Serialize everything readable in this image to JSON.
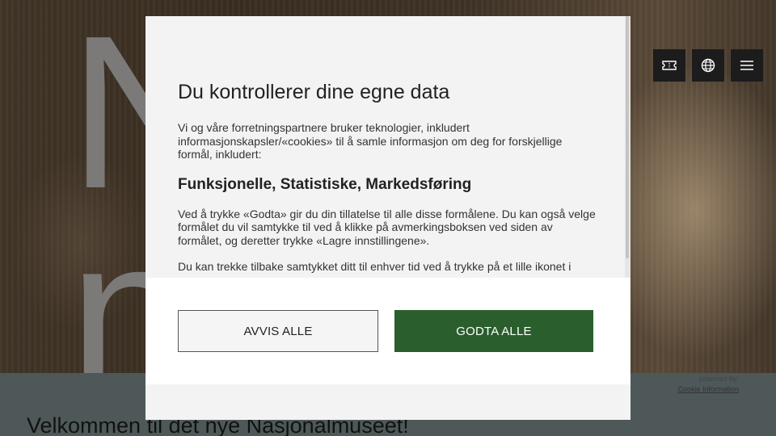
{
  "hero": {
    "letters": [
      "N",
      "n"
    ]
  },
  "top_buttons": [
    {
      "icon": "ticket-icon",
      "label": "Ticket"
    },
    {
      "icon": "globe-icon",
      "label": "Language"
    },
    {
      "icon": "menu-icon",
      "label": "Menu"
    }
  ],
  "page": {
    "welcome": "Velkommen til det nye Nasjonalmuseet!"
  },
  "cookie_dialog": {
    "title": "Du kontrollerer dine egne data",
    "intro": "Vi og våre forretningspartnere bruker teknologier, inkludert informasjonskapsler/«cookies» til å samle informasjon om deg for forskjellige formål, inkludert:",
    "purposes": "Funksjonelle, Statistiske, Markedsføring",
    "consent_text": "Ved å trykke «Godta» gir du din tillatelse til alle disse formålene. Du kan også velge formålet du vil samtykke til ved å klikke på avmerkingsboksen ved siden av formålet, og deretter trykke «Lagre innstillingene».",
    "withdraw_text": "Du kan trekke tilbake samtykket ditt til enhver tid ved å trykke på et lille ikonet i",
    "reject_label": "AVVIS ALLE",
    "accept_label": "GODTA ALLE",
    "powered_by": "powered by:",
    "provider": "Cookie Information"
  },
  "colors": {
    "accept": "#2a5e2c",
    "dialog_bg": "#f3f3f3",
    "band": "#4e5859"
  }
}
